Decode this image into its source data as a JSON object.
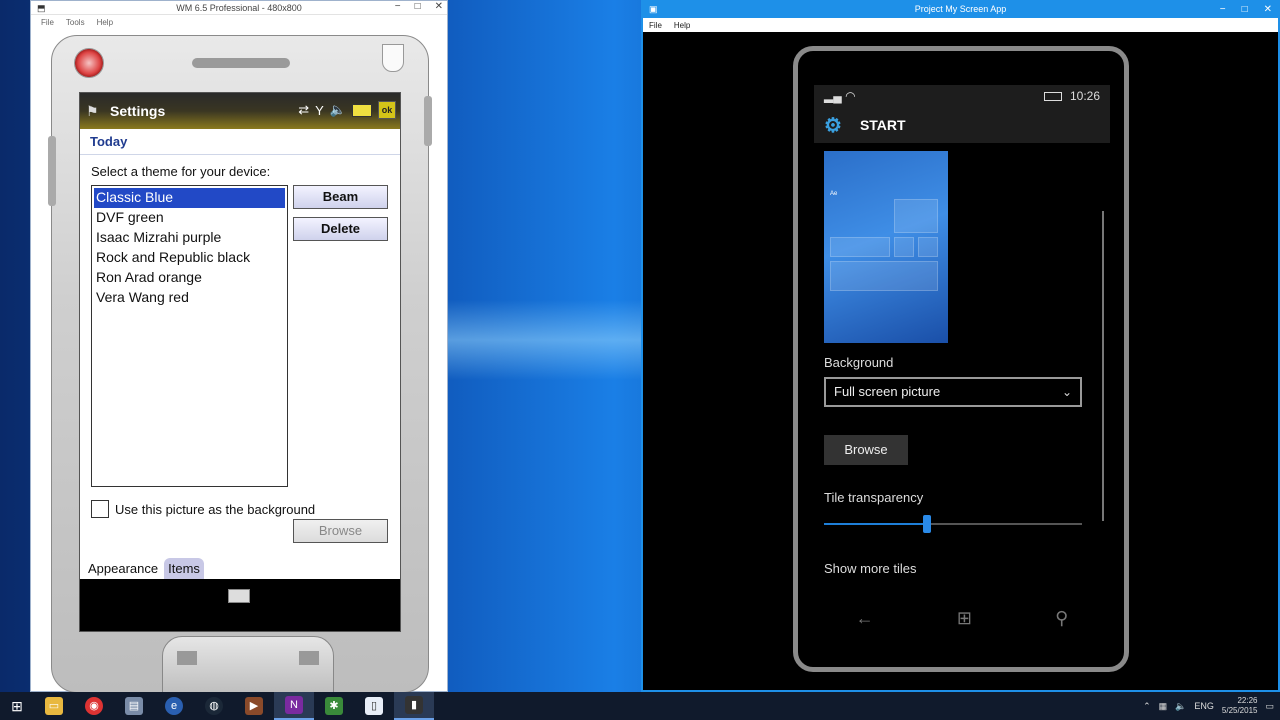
{
  "left_window": {
    "title": "WM 6.5 Professional - 480x800",
    "menu": [
      "File",
      "Tools",
      "Help"
    ],
    "controls": [
      "−",
      "□",
      "✕"
    ],
    "device": {
      "app_title": "Settings",
      "sub_title": "Today",
      "prompt": "Select a theme for your device:",
      "themes": [
        "Classic Blue",
        "DVF green",
        "Isaac Mizrahi purple",
        "Rock and Republic black",
        "Ron Arad orange",
        "Vera Wang red"
      ],
      "selected_theme": "Classic Blue",
      "beam_label": "Beam",
      "delete_label": "Delete",
      "checkbox_label": "Use this picture as the background",
      "browse_label": "Browse",
      "tabs": [
        "Appearance",
        "Items"
      ],
      "ok_label": "ok"
    }
  },
  "right_window": {
    "title": "Project My Screen App",
    "menu": [
      "File",
      "Help"
    ],
    "controls": [
      "−",
      "□",
      "✕"
    ],
    "phone": {
      "time": "10:26",
      "header": "START",
      "preview_tile_text": "Ae",
      "background_label": "Background",
      "background_value": "Full screen picture",
      "browse_label": "Browse",
      "transparency_label": "Tile transparency",
      "transparency_fraction": 0.4,
      "more_tiles_label": "Show more tiles"
    }
  },
  "taskbar": {
    "lang": "ENG",
    "time": "22:26",
    "date": "5/25/2015"
  },
  "colors": {
    "accent_blue": "#1e90e8",
    "wm_selection": "#2249c6"
  }
}
